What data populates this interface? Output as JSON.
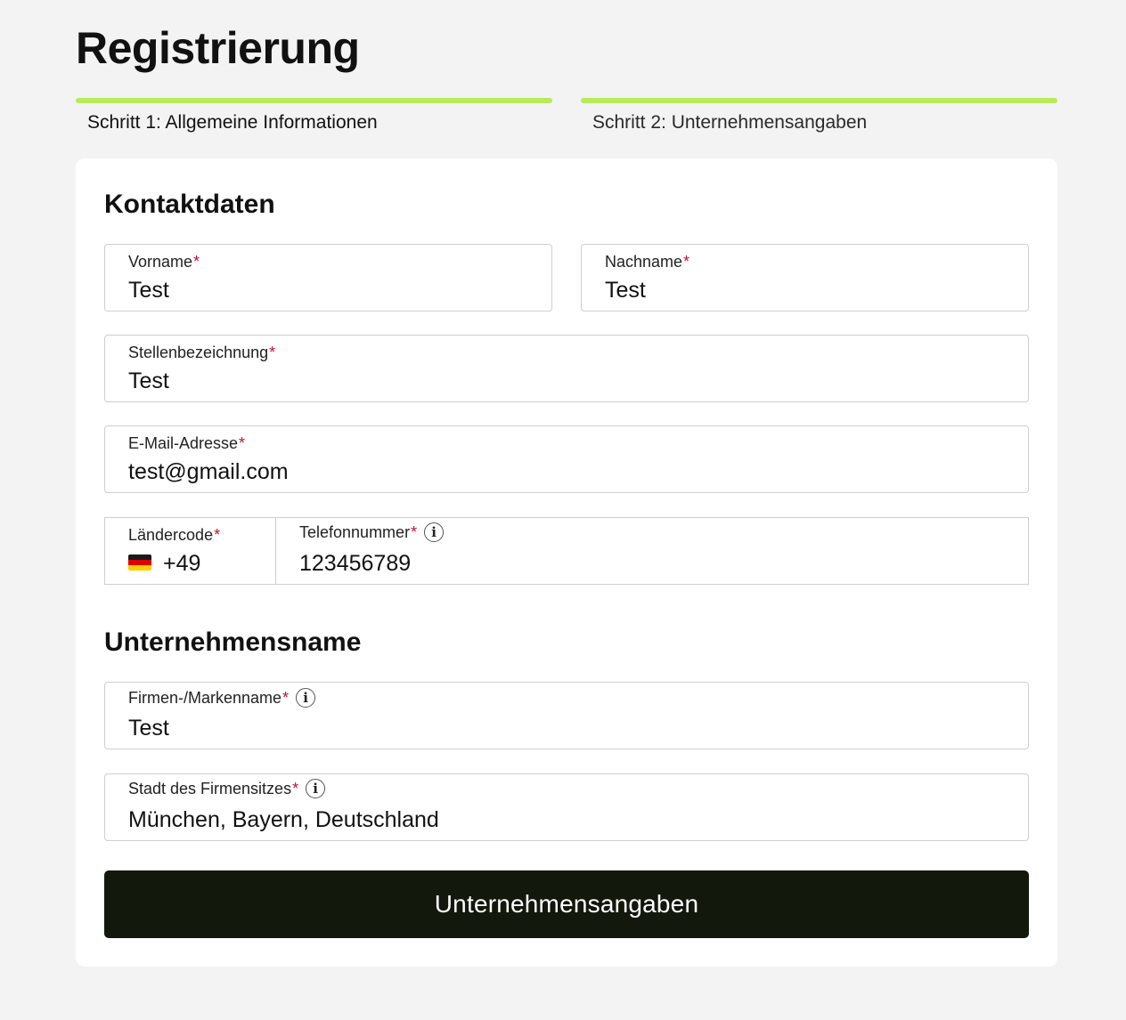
{
  "page": {
    "title": "Registrierung"
  },
  "steps": [
    {
      "label": "Schritt 1: Allgemeine Informationen",
      "active": true
    },
    {
      "label": "Schritt 2: Unternehmensangaben",
      "active": false
    }
  ],
  "colors": {
    "accent": "#b8ea5a",
    "required": "#c8102e",
    "button_bg": "#13180d",
    "page_bg": "#f3f3f3"
  },
  "contact": {
    "title": "Kontaktdaten",
    "first_name": {
      "label": "Vorname",
      "required_mark": "*",
      "value": "Test"
    },
    "last_name": {
      "label": "Nachname",
      "required_mark": "*",
      "value": "Test"
    },
    "job_title": {
      "label": "Stellenbezeichnung",
      "required_mark": "*",
      "value": "Test"
    },
    "email": {
      "label": "E-Mail-Adresse",
      "required_mark": "*",
      "value": "test@gmail.com"
    },
    "country_code": {
      "label": "Ländercode",
      "required_mark": "*",
      "value": "+49",
      "flag": "germany-flag-icon"
    },
    "phone": {
      "label": "Telefonnummer",
      "required_mark": "*",
      "value": "123456789",
      "info_icon": "i"
    }
  },
  "company": {
    "title": "Unternehmensname",
    "brand_name": {
      "label": "Firmen-/Markenname",
      "required_mark": "*",
      "value": "Test",
      "info_icon": "i"
    },
    "city": {
      "label": "Stadt des Firmensitzes",
      "required_mark": "*",
      "value": "München, Bayern, Deutschland",
      "info_icon": "i"
    }
  },
  "submit": {
    "label": "Unternehmensangaben"
  }
}
